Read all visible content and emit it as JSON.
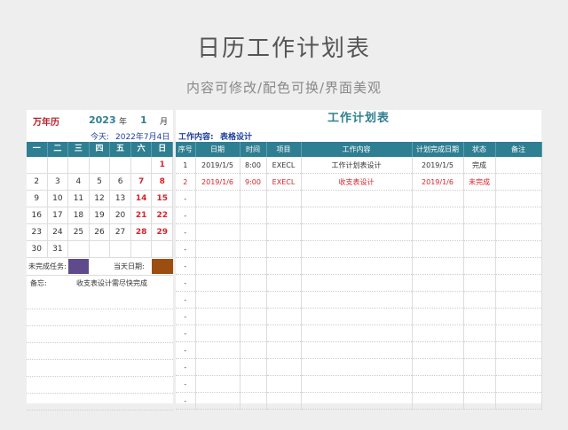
{
  "header": {
    "title": "日历工作计划表",
    "subtitle": "内容可修改/配色可换/界面美观"
  },
  "calendar": {
    "brand": "万年历",
    "year": "2023",
    "year_label": "年",
    "month": "1",
    "month_label": "月",
    "today_label": "今天:",
    "today_value": "2022年7月4日",
    "weekdays": [
      "一",
      "二",
      "三",
      "四",
      "五",
      "六",
      "日"
    ],
    "days": [
      [
        "",
        "",
        "",
        "",
        "",
        "",
        "1"
      ],
      [
        "2",
        "3",
        "4",
        "5",
        "6",
        "7",
        "8"
      ],
      [
        "9",
        "10",
        "11",
        "12",
        "13",
        "14",
        "15"
      ],
      [
        "16",
        "17",
        "18",
        "19",
        "20",
        "21",
        "22"
      ],
      [
        "23",
        "24",
        "25",
        "26",
        "27",
        "28",
        "29"
      ],
      [
        "30",
        "31",
        "",
        "",
        "",
        "",
        ""
      ]
    ],
    "unfinished_label": "未完成任务:",
    "unfinished_color": "#5f4b8b",
    "today_date_label": "当天日期:",
    "today_date_color": "#9c4d10",
    "memo_label": "备忘:",
    "memo_value": "收支表设计需尽快完成"
  },
  "plan": {
    "title": "工作计划表",
    "content_label": "工作内容:",
    "content_value": "表格设计",
    "columns": [
      "序号",
      "日期",
      "时间",
      "项目",
      "工作内容",
      "计划完成日期",
      "状态",
      "备注"
    ],
    "rows": [
      [
        "1",
        "2019/1/5",
        "8:00",
        "EXECL",
        "工作计划表设计",
        "2019/1/5",
        "完成",
        ""
      ],
      [
        "2",
        "2019/1/6",
        "9:00",
        "EXECL",
        "收支表设计",
        "2019/1/6",
        "未完成",
        ""
      ],
      [
        "-",
        "",
        "",
        "",
        "",
        "",
        "",
        ""
      ],
      [
        "-",
        "",
        "",
        "",
        "",
        "",
        "",
        ""
      ],
      [
        "-",
        "",
        "",
        "",
        "",
        "",
        "",
        ""
      ],
      [
        "-",
        "",
        "",
        "",
        "",
        "",
        "",
        ""
      ],
      [
        "-",
        "",
        "",
        "",
        "",
        "",
        "",
        ""
      ],
      [
        "-",
        "",
        "",
        "",
        "",
        "",
        "",
        ""
      ],
      [
        "-",
        "",
        "",
        "",
        "",
        "",
        "",
        ""
      ],
      [
        "-",
        "",
        "",
        "",
        "",
        "",
        "",
        ""
      ],
      [
        "-",
        "",
        "",
        "",
        "",
        "",
        "",
        ""
      ],
      [
        "-",
        "",
        "",
        "",
        "",
        "",
        "",
        ""
      ],
      [
        "-",
        "",
        "",
        "",
        "",
        "",
        "",
        ""
      ],
      [
        "-",
        "",
        "",
        "",
        "",
        "",
        "",
        ""
      ],
      [
        "-",
        "",
        "",
        "",
        "",
        "",
        "",
        ""
      ]
    ],
    "highlight_row": 1,
    "highlight_color": "#d8232a"
  }
}
